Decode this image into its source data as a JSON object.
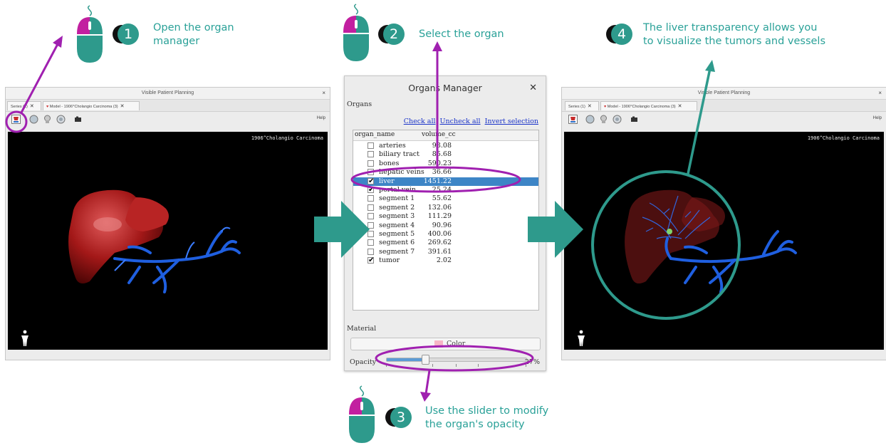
{
  "steps": [
    {
      "number": "1",
      "text_line1": "Open the organ",
      "text_line2": "manager"
    },
    {
      "number": "2",
      "text_line1": "Select the organ"
    },
    {
      "number": "3",
      "text_line1": "Use the slider to modify",
      "text_line2": "the organ's opacity"
    },
    {
      "number": "4",
      "text_line1": "The liver transparency allows you",
      "text_line2": "to visualize the tumors and vessels"
    }
  ],
  "left_window": {
    "title": "Visible Patient Planning",
    "tabs": [
      {
        "label": "Series (1)"
      },
      {
        "label": "Model - 1906^Cholangio Carcinoma (3)"
      }
    ],
    "help_label": "Help",
    "viewport_label": "1906^Cholangio Carcinoma"
  },
  "right_window": {
    "title": "Visible Patient Planning",
    "tabs": [
      {
        "label": "Series (1)"
      },
      {
        "label": "Model - 1906^Cholangio Carcinoma (3)"
      }
    ],
    "help_label": "Help",
    "viewport_label": "1906^Cholangio Carcinoma"
  },
  "organs_manager": {
    "title": "Organs Manager",
    "section_label": "Organs",
    "links": {
      "check_all": "Check all",
      "uncheck_all": "Uncheck all",
      "invert": "Invert selection"
    },
    "columns": [
      "organ_name",
      "volume_cc"
    ],
    "rows": [
      {
        "name": "arteries",
        "volume": "93.08",
        "checked": false,
        "selected": false
      },
      {
        "name": "biliary tract",
        "volume": "85.68",
        "checked": false,
        "selected": false
      },
      {
        "name": "bones",
        "volume": "590.23",
        "checked": false,
        "selected": false
      },
      {
        "name": "hepatic veins",
        "volume": "36.66",
        "checked": false,
        "selected": false
      },
      {
        "name": "liver",
        "volume": "1451.22",
        "checked": true,
        "selected": true
      },
      {
        "name": "portal vein",
        "volume": "25.24",
        "checked": true,
        "selected": false
      },
      {
        "name": "segment 1",
        "volume": "55.62",
        "checked": false,
        "selected": false
      },
      {
        "name": "segment 2",
        "volume": "132.06",
        "checked": false,
        "selected": false
      },
      {
        "name": "segment 3",
        "volume": "111.29",
        "checked": false,
        "selected": false
      },
      {
        "name": "segment 4",
        "volume": "90.96",
        "checked": false,
        "selected": false
      },
      {
        "name": "segment 5",
        "volume": "400.06",
        "checked": false,
        "selected": false
      },
      {
        "name": "segment 6",
        "volume": "269.62",
        "checked": false,
        "selected": false
      },
      {
        "name": "segment 7",
        "volume": "391.61",
        "checked": false,
        "selected": false
      },
      {
        "name": "tumor",
        "volume": "2.02",
        "checked": true,
        "selected": false
      }
    ],
    "material_label": "Material",
    "color_button_label": "Color",
    "swatch_color": "#f7b6c6",
    "opacity_label": "Opacity",
    "opacity_value": "27%",
    "opacity_fraction": 0.27
  },
  "colors": {
    "teal": "#2e9a8c",
    "purple": "#a020b0",
    "selection_blue": "#3d85c6"
  }
}
